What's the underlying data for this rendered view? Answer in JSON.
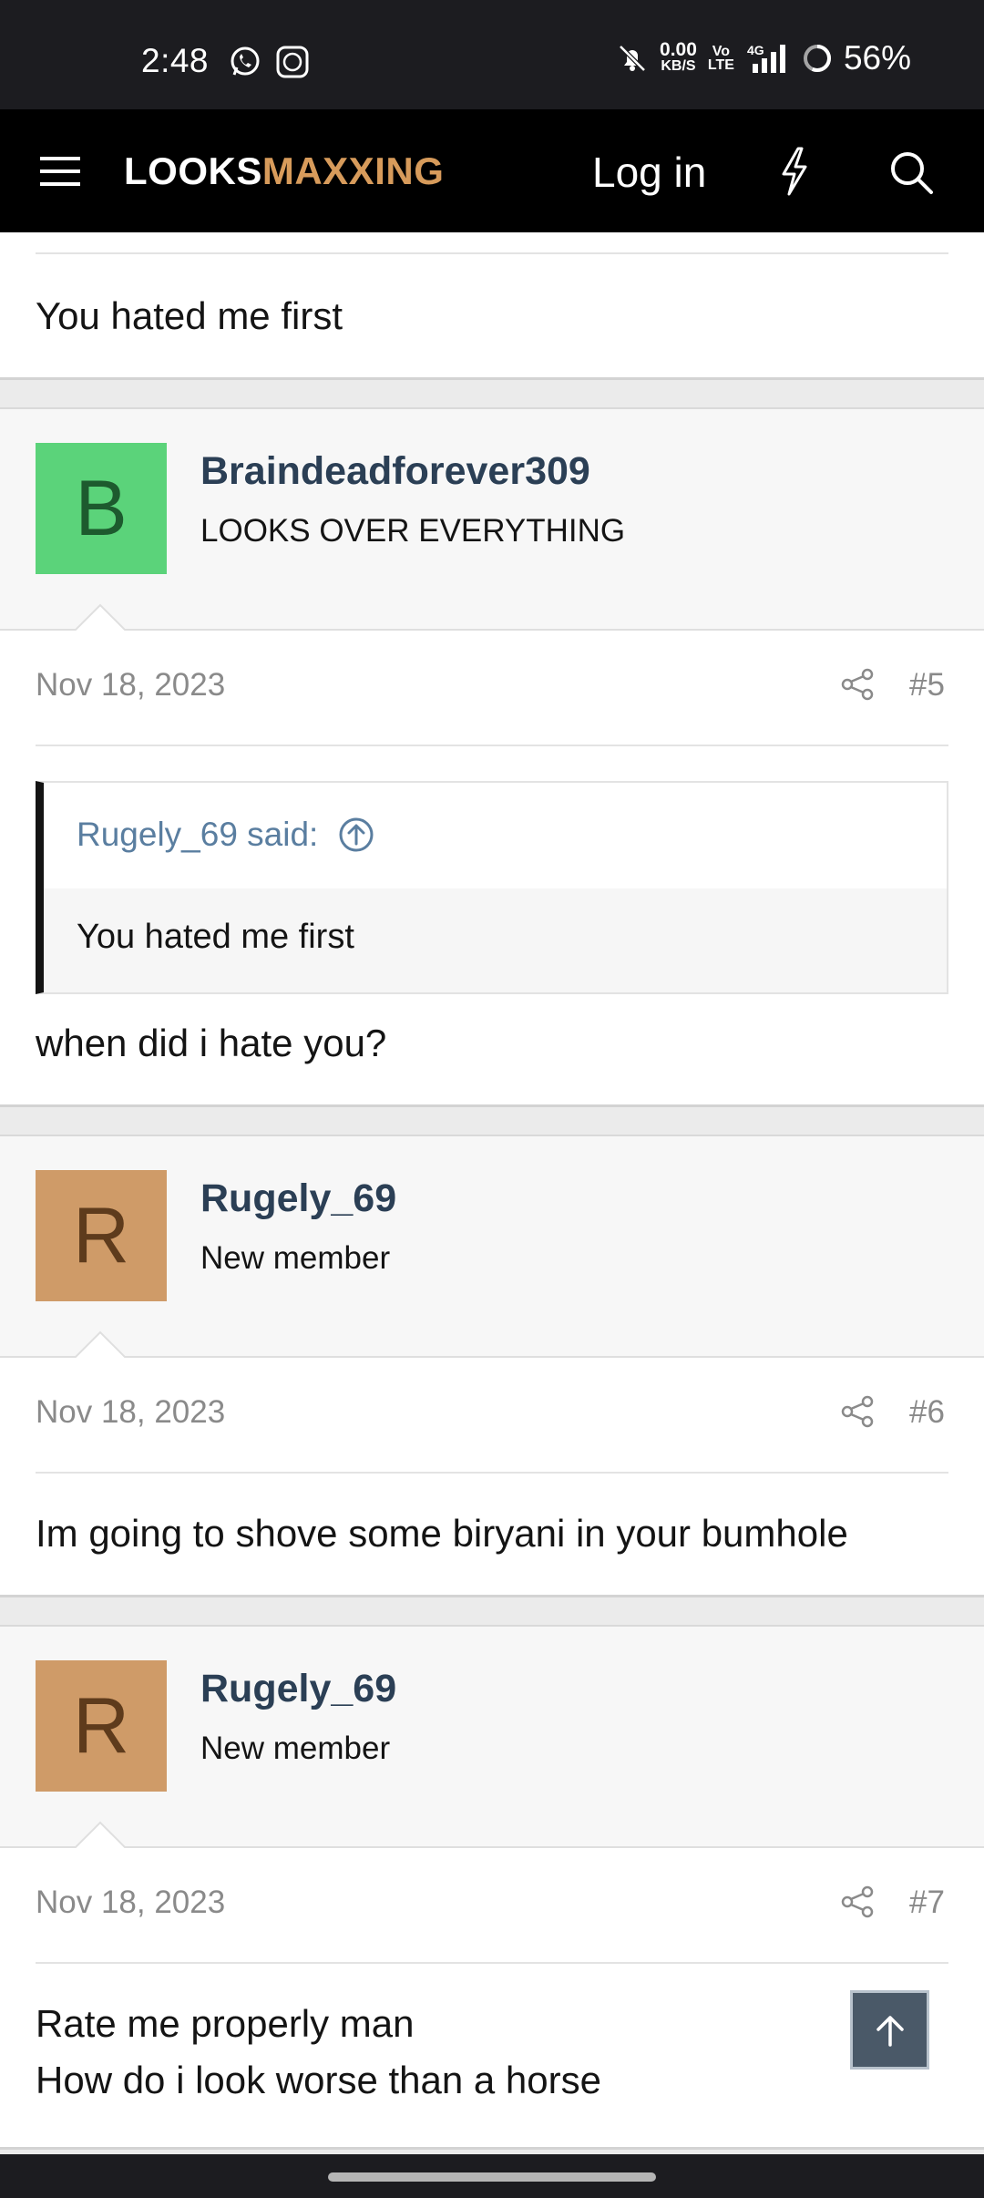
{
  "status_bar": {
    "time": "2:48",
    "net_speed": "0.00",
    "net_unit": "KB/S",
    "volte_top": "Vo",
    "volte_bottom": "LTE",
    "network": "4G",
    "battery": "56%"
  },
  "header": {
    "logo_part1": "LOOKS",
    "logo_part2": "MAXXING",
    "login_label": "Log in",
    "brand_color": "#d79b5b"
  },
  "prev_post": {
    "text": "You hated me first"
  },
  "posts": [
    {
      "avatar_letter": "B",
      "avatar_bg": "#5bd37a",
      "username": "Braindeadforever309",
      "user_title": "LOOKS OVER EVERYTHING",
      "date": "Nov 18, 2023",
      "number": "#5",
      "quote": {
        "author_said": "Rugely_69 said:",
        "text": "You hated me first"
      },
      "text": "when did i hate you?"
    },
    {
      "avatar_letter": "R",
      "avatar_bg": "#cf9b68",
      "username": "Rugely_69",
      "user_title": "New member",
      "date": "Nov 18, 2023",
      "number": "#6",
      "text": "Im going to shove some biryani in your bumhole"
    },
    {
      "avatar_letter": "R",
      "avatar_bg": "#cf9b68",
      "username": "Rugely_69",
      "user_title": "New member",
      "date": "Nov 18, 2023",
      "number": "#7",
      "text_line1": "Rate me properly man",
      "text_line2": "How do i look worse than a horse"
    }
  ]
}
